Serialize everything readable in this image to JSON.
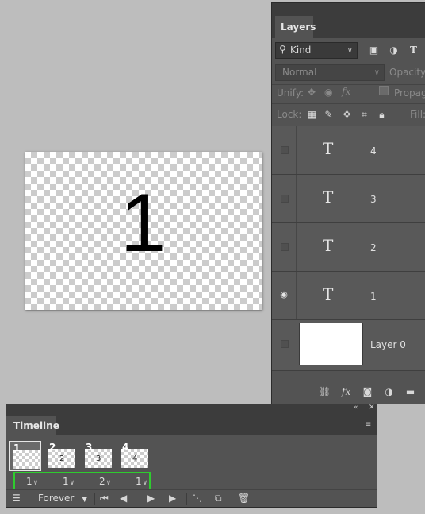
{
  "canvas": {
    "text": "1"
  },
  "layers_panel": {
    "tab": "Layers",
    "filter_kind": "Kind",
    "filter_icons": [
      "image-filter-icon",
      "adjustment-filter-icon",
      "type-filter-icon"
    ],
    "blend_mode": "Normal",
    "opacity_label": "Opacity:",
    "unify_label": "Unify:",
    "propagate_label": "Propaga",
    "lock_label": "Lock:",
    "fill_label": "Fill:",
    "layers": [
      {
        "name": "4",
        "type": "text",
        "visible": false
      },
      {
        "name": "3",
        "type": "text",
        "visible": false
      },
      {
        "name": "2",
        "type": "text",
        "visible": false
      },
      {
        "name": "1",
        "type": "text",
        "visible": true
      },
      {
        "name": "Layer 0",
        "type": "image",
        "visible": false
      }
    ],
    "type_glyph": "T",
    "footer_icons": [
      "link-layers-icon",
      "fx-icon",
      "add-mask-icon",
      "adjustment-icon",
      "folder-icon"
    ]
  },
  "timeline": {
    "tab": "Timeline",
    "frames": [
      {
        "number": "1",
        "inner": "",
        "delay": "1"
      },
      {
        "number": "2",
        "inner": "2",
        "delay": "1"
      },
      {
        "number": "3",
        "inner": "3",
        "delay": "2"
      },
      {
        "number": "4",
        "inner": "4",
        "delay": "1"
      }
    ],
    "loop": "Forever",
    "selected_frame": 1
  }
}
